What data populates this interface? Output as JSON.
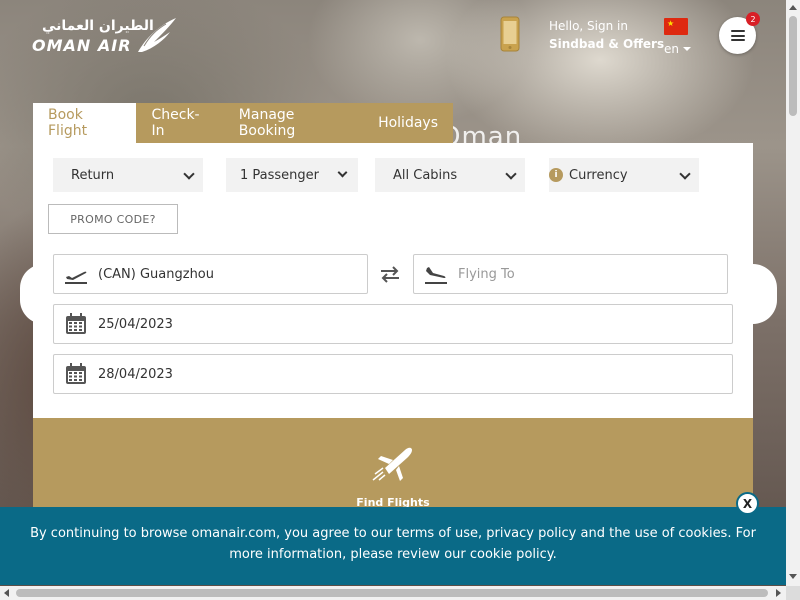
{
  "colors": {
    "gold": "#b69a5e",
    "cookie_bg": "#0a6a87",
    "badge": "#d81f26",
    "flag": "#de2910"
  },
  "hero": {
    "title": "Oman"
  },
  "header": {
    "logo_arabic": "الطيران العماني",
    "logo_english": "OMAN AIR",
    "signin_label": "Hello, Sign in",
    "sindbad_label": "Sindbad & Offers",
    "language": "en",
    "menu_badge": "2",
    "flag_star": "★"
  },
  "tabs": [
    {
      "label": "Book Flight",
      "active": true
    },
    {
      "label": "Check-In"
    },
    {
      "label": "Manage Booking"
    },
    {
      "label": "Holidays"
    }
  ],
  "booking": {
    "trip_type": "Return",
    "passengers": "1 Passenger",
    "cabin": "All Cabins",
    "currency": "Currency",
    "currency_info": "i",
    "promo_code": "PROMO CODE?",
    "from_value": "(CAN) Guangzhou",
    "to_placeholder": "Flying To",
    "depart_date": "25/04/2023",
    "return_date": "28/04/2023",
    "find_flights": "Find Flights"
  },
  "cookie": {
    "text": "By continuing to browse omanair.com, you agree to our terms of use, privacy policy and the use of cookies. For more information, please review our cookie policy.",
    "close_label": "X"
  }
}
